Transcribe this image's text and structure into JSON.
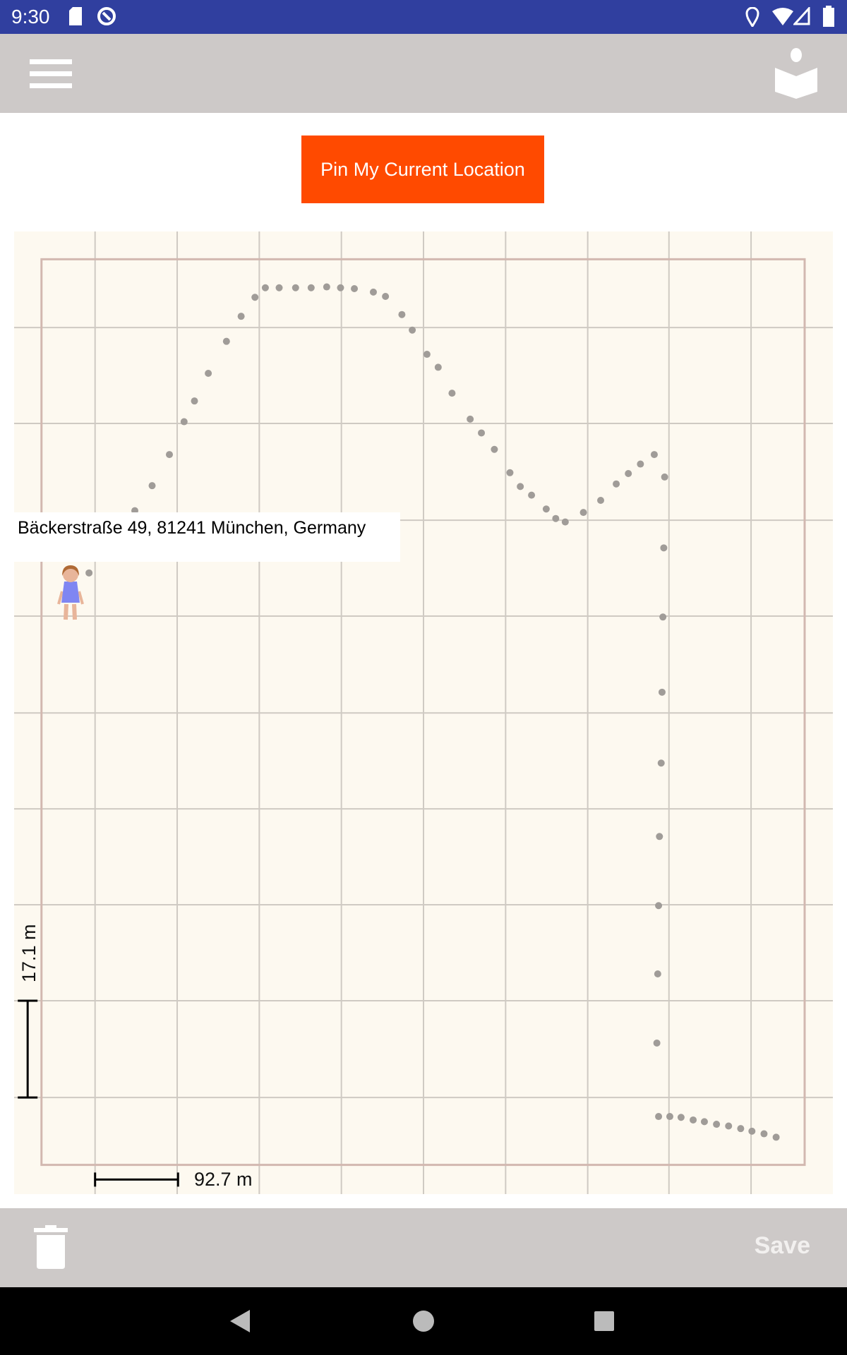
{
  "status_bar": {
    "time": "9:30",
    "icons": [
      "sd-card-icon",
      "sync-icon",
      "location-icon",
      "wifi-icon",
      "signal-icon",
      "battery-icon"
    ]
  },
  "toolbar": {
    "menu_icon": "hamburger-menu-icon",
    "action_icon": "reader-book-icon"
  },
  "pin_button": {
    "label": "Pin My Current Location",
    "color": "#ff4a00"
  },
  "map": {
    "address_label": "Bäckerstraße 49, 81241 München, Germany",
    "horizontal_scale": "92.7 m",
    "vertical_scale": "17.1 m",
    "marker_icon": "child-avatar-icon",
    "track_color": "#a09c98",
    "grid_color": "#cfcac3",
    "background_color": "#fdf9f0"
  },
  "bottom_bar": {
    "delete_icon": "trash-icon",
    "save_label": "Save"
  },
  "nav_bar": {
    "icons": [
      "back-icon",
      "home-icon",
      "recents-icon"
    ]
  }
}
